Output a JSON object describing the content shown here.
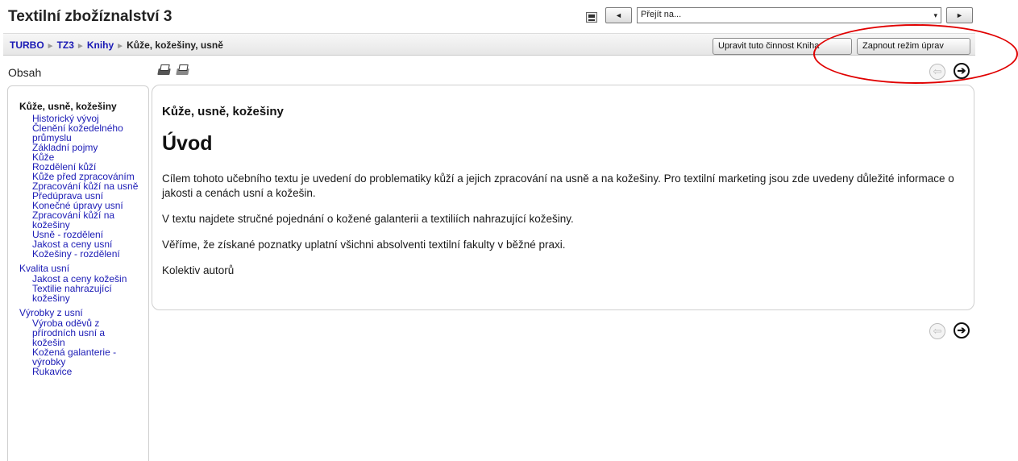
{
  "header": {
    "title": "Textilní zbožíznalství 3",
    "jump_select_value": "Přejít na...",
    "prev_button_glyph": "◄",
    "next_button_glyph": "►",
    "select_arrow_glyph": "▾"
  },
  "breadcrumb": {
    "items": [
      "TURBO",
      "TZ3",
      "Knihy"
    ],
    "current": "Kůže, kožešiny, usně",
    "separator": "►"
  },
  "buttons": {
    "edit_activity": "Upravit tuto činnost Kniha",
    "edit_mode": "Zapnout režim úprav"
  },
  "toc": {
    "label": "Obsah",
    "chapters": [
      {
        "title": "Kůže, usně, kožešiny",
        "current": true,
        "subs": [
          "Historický vývoj",
          "Členění kožedelného průmyslu",
          "Základní pojmy",
          "Kůže",
          "Rozdělení kůží",
          "Kůže před zpracováním",
          "Zpracování kůží na usně",
          "Předúprava usní",
          "Konečné úpravy usní",
          "Zpracování kůží na kožešiny",
          "Usně - rozdělení",
          "Jakost a ceny usní",
          "Kožešiny - rozdělení"
        ]
      },
      {
        "title": "Kvalita usní",
        "current": false,
        "subs": [
          "Jakost a ceny kožešin",
          "Textilie nahrazující kožešiny"
        ]
      },
      {
        "title": "Výrobky z usní",
        "current": false,
        "subs": [
          "Výroba oděvů z přírodních usní a kožešin",
          "Kožená galanterie - výrobky",
          "Rukavice"
        ]
      }
    ]
  },
  "nav": {
    "prev_glyph": "⇦",
    "next_glyph": "➔"
  },
  "content": {
    "chapter_title": "Kůže, usně, kožešiny",
    "heading": "Úvod",
    "paragraphs": [
      "Cílem tohoto učebního textu je uvedení do problematiky kůží a jejich zpracování na usně a na kožešiny. Pro textilní marketing jsou zde uvedeny důležité informace o jakosti a cenách usní a kožešin.",
      "V textu najdete stručné pojednání o kožené galanterii a textiliích nahrazující kožešiny.",
      "Věříme, že získané poznatky uplatní všichni absolventi textilní fakulty v běžné praxi.",
      "Kolektiv autorů"
    ]
  },
  "colors": {
    "link": "#1a1ab5",
    "annotation": "#e00000"
  }
}
